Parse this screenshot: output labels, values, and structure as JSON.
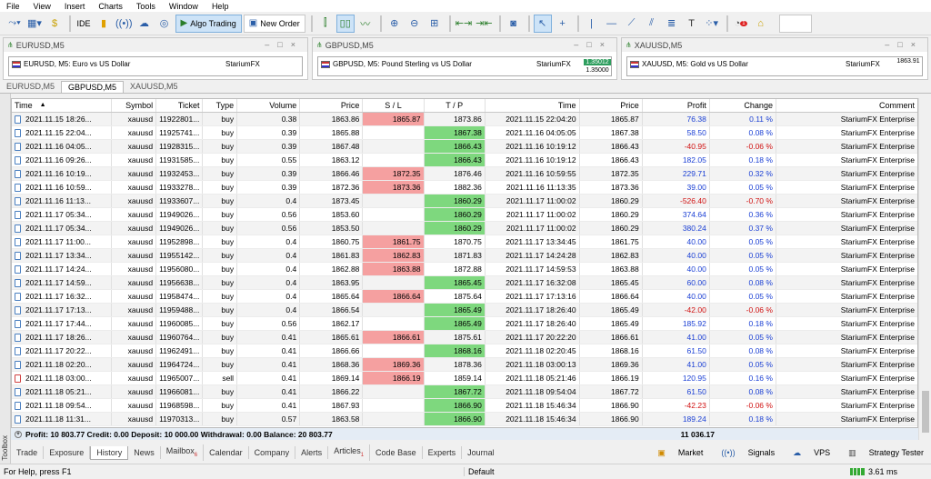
{
  "menu": [
    "File",
    "View",
    "Insert",
    "Charts",
    "Tools",
    "Window",
    "Help"
  ],
  "toolbar": {
    "ide_label": "IDE",
    "algo_label": "Algo Trading",
    "new_order_label": "New Order"
  },
  "chart_windows": [
    {
      "title": "EURUSD,M5",
      "label": "EURUSD, M5:  Euro vs US Dollar",
      "brand": "StariumFX"
    },
    {
      "title": "GBPUSD,M5",
      "label": "GBPUSD, M5:  Pound Sterling vs US Dollar",
      "brand": "StariumFX",
      "price_a": "1.35012",
      "price_b": "1.35000"
    },
    {
      "title": "XAUUSD,M5",
      "label": "XAUUSD, M5:  Gold vs US Dollar",
      "brand": "StariumFX",
      "price_a": "1863.91"
    }
  ],
  "chart_tabs": [
    "EURUSD,M5",
    "GBPUSD,M5",
    "XAUUSD,M5"
  ],
  "columns": [
    "Time",
    "Symbol",
    "Ticket",
    "Type",
    "Volume",
    "Price",
    "S / L",
    "T / P",
    "Time",
    "Price",
    "Profit",
    "Change",
    "Comment"
  ],
  "rows": [
    {
      "time": "2021.11.15 18:26...",
      "symbol": "xauusd",
      "ticket": "11922801...",
      "type": "buy",
      "volume": "0.38",
      "price": "1863.86",
      "sl": "1865.87",
      "tp": "1873.86",
      "ctime": "2021.11.15 22:04:20",
      "cprice": "1865.87",
      "profit": "76.38",
      "change": "0.11 %",
      "comment": "StariumFX Enterprise",
      "sl_hit": true,
      "tp_hit": false,
      "neg": false
    },
    {
      "time": "2021.11.15 22:04...",
      "symbol": "xauusd",
      "ticket": "11925741...",
      "type": "buy",
      "volume": "0.39",
      "price": "1865.88",
      "sl": "",
      "tp": "1867.38",
      "ctime": "2021.11.16 04:05:05",
      "cprice": "1867.38",
      "profit": "58.50",
      "change": "0.08 %",
      "comment": "StariumFX Enterprise",
      "sl_hit": false,
      "tp_hit": true,
      "neg": false
    },
    {
      "time": "2021.11.16 04:05...",
      "symbol": "xauusd",
      "ticket": "11928315...",
      "type": "buy",
      "volume": "0.39",
      "price": "1867.48",
      "sl": "",
      "tp": "1866.43",
      "ctime": "2021.11.16 10:19:12",
      "cprice": "1866.43",
      "profit": "-40.95",
      "change": "-0.06 %",
      "comment": "StariumFX Enterprise",
      "sl_hit": false,
      "tp_hit": true,
      "neg": true
    },
    {
      "time": "2021.11.16 09:26...",
      "symbol": "xauusd",
      "ticket": "11931585...",
      "type": "buy",
      "volume": "0.55",
      "price": "1863.12",
      "sl": "",
      "tp": "1866.43",
      "ctime": "2021.11.16 10:19:12",
      "cprice": "1866.43",
      "profit": "182.05",
      "change": "0.18 %",
      "comment": "StariumFX Enterprise",
      "sl_hit": false,
      "tp_hit": true,
      "neg": false
    },
    {
      "time": "2021.11.16 10:19...",
      "symbol": "xauusd",
      "ticket": "11932453...",
      "type": "buy",
      "volume": "0.39",
      "price": "1866.46",
      "sl": "1872.35",
      "tp": "1876.46",
      "ctime": "2021.11.16 10:59:55",
      "cprice": "1872.35",
      "profit": "229.71",
      "change": "0.32 %",
      "comment": "StariumFX Enterprise",
      "sl_hit": true,
      "tp_hit": false,
      "neg": false
    },
    {
      "time": "2021.11.16 10:59...",
      "symbol": "xauusd",
      "ticket": "11933278...",
      "type": "buy",
      "volume": "0.39",
      "price": "1872.36",
      "sl": "1873.36",
      "tp": "1882.36",
      "ctime": "2021.11.16 11:13:35",
      "cprice": "1873.36",
      "profit": "39.00",
      "change": "0.05 %",
      "comment": "StariumFX Enterprise",
      "sl_hit": true,
      "tp_hit": false,
      "neg": false
    },
    {
      "time": "2021.11.16 11:13...",
      "symbol": "xauusd",
      "ticket": "11933607...",
      "type": "buy",
      "volume": "0.4",
      "price": "1873.45",
      "sl": "",
      "tp": "1860.29",
      "ctime": "2021.11.17 11:00:02",
      "cprice": "1860.29",
      "profit": "-526.40",
      "change": "-0.70 %",
      "comment": "StariumFX Enterprise",
      "sl_hit": false,
      "tp_hit": true,
      "neg": true
    },
    {
      "time": "2021.11.17 05:34...",
      "symbol": "xauusd",
      "ticket": "11949026...",
      "type": "buy",
      "volume": "0.56",
      "price": "1853.60",
      "sl": "",
      "tp": "1860.29",
      "ctime": "2021.11.17 11:00:02",
      "cprice": "1860.29",
      "profit": "374.64",
      "change": "0.36 %",
      "comment": "StariumFX Enterprise",
      "sl_hit": false,
      "tp_hit": true,
      "neg": false
    },
    {
      "time": "2021.11.17 05:34...",
      "symbol": "xauusd",
      "ticket": "11949026...",
      "type": "buy",
      "volume": "0.56",
      "price": "1853.50",
      "sl": "",
      "tp": "1860.29",
      "ctime": "2021.11.17 11:00:02",
      "cprice": "1860.29",
      "profit": "380.24",
      "change": "0.37 %",
      "comment": "StariumFX Enterprise",
      "sl_hit": false,
      "tp_hit": true,
      "neg": false
    },
    {
      "time": "2021.11.17 11:00...",
      "symbol": "xauusd",
      "ticket": "11952898...",
      "type": "buy",
      "volume": "0.4",
      "price": "1860.75",
      "sl": "1861.75",
      "tp": "1870.75",
      "ctime": "2021.11.17 13:34:45",
      "cprice": "1861.75",
      "profit": "40.00",
      "change": "0.05 %",
      "comment": "StariumFX Enterprise",
      "sl_hit": true,
      "tp_hit": false,
      "neg": false
    },
    {
      "time": "2021.11.17 13:34...",
      "symbol": "xauusd",
      "ticket": "11955142...",
      "type": "buy",
      "volume": "0.4",
      "price": "1861.83",
      "sl": "1862.83",
      "tp": "1871.83",
      "ctime": "2021.11.17 14:24:28",
      "cprice": "1862.83",
      "profit": "40.00",
      "change": "0.05 %",
      "comment": "StariumFX Enterprise",
      "sl_hit": true,
      "tp_hit": false,
      "neg": false
    },
    {
      "time": "2021.11.17 14:24...",
      "symbol": "xauusd",
      "ticket": "11956080...",
      "type": "buy",
      "volume": "0.4",
      "price": "1862.88",
      "sl": "1863.88",
      "tp": "1872.88",
      "ctime": "2021.11.17 14:59:53",
      "cprice": "1863.88",
      "profit": "40.00",
      "change": "0.05 %",
      "comment": "StariumFX Enterprise",
      "sl_hit": true,
      "tp_hit": false,
      "neg": false
    },
    {
      "time": "2021.11.17 14:59...",
      "symbol": "xauusd",
      "ticket": "11956638...",
      "type": "buy",
      "volume": "0.4",
      "price": "1863.95",
      "sl": "",
      "tp": "1865.45",
      "ctime": "2021.11.17 16:32:08",
      "cprice": "1865.45",
      "profit": "60.00",
      "change": "0.08 %",
      "comment": "StariumFX Enterprise",
      "sl_hit": false,
      "tp_hit": true,
      "neg": false
    },
    {
      "time": "2021.11.17 16:32...",
      "symbol": "xauusd",
      "ticket": "11958474...",
      "type": "buy",
      "volume": "0.4",
      "price": "1865.64",
      "sl": "1866.64",
      "tp": "1875.64",
      "ctime": "2021.11.17 17:13:16",
      "cprice": "1866.64",
      "profit": "40.00",
      "change": "0.05 %",
      "comment": "StariumFX Enterprise",
      "sl_hit": true,
      "tp_hit": false,
      "neg": false
    },
    {
      "time": "2021.11.17 17:13...",
      "symbol": "xauusd",
      "ticket": "11959488...",
      "type": "buy",
      "volume": "0.4",
      "price": "1866.54",
      "sl": "",
      "tp": "1865.49",
      "ctime": "2021.11.17 18:26:40",
      "cprice": "1865.49",
      "profit": "-42.00",
      "change": "-0.06 %",
      "comment": "StariumFX Enterprise",
      "sl_hit": false,
      "tp_hit": true,
      "neg": true
    },
    {
      "time": "2021.11.17 17:44...",
      "symbol": "xauusd",
      "ticket": "11960085...",
      "type": "buy",
      "volume": "0.56",
      "price": "1862.17",
      "sl": "",
      "tp": "1865.49",
      "ctime": "2021.11.17 18:26:40",
      "cprice": "1865.49",
      "profit": "185.92",
      "change": "0.18 %",
      "comment": "StariumFX Enterprise",
      "sl_hit": false,
      "tp_hit": true,
      "neg": false
    },
    {
      "time": "2021.11.17 18:26...",
      "symbol": "xauusd",
      "ticket": "11960764...",
      "type": "buy",
      "volume": "0.41",
      "price": "1865.61",
      "sl": "1866.61",
      "tp": "1875.61",
      "ctime": "2021.11.17 20:22:20",
      "cprice": "1866.61",
      "profit": "41.00",
      "change": "0.05 %",
      "comment": "StariumFX Enterprise",
      "sl_hit": true,
      "tp_hit": false,
      "neg": false
    },
    {
      "time": "2021.11.17 20:22...",
      "symbol": "xauusd",
      "ticket": "11962491...",
      "type": "buy",
      "volume": "0.41",
      "price": "1866.66",
      "sl": "",
      "tp": "1868.16",
      "ctime": "2021.11.18 02:20:45",
      "cprice": "1868.16",
      "profit": "61.50",
      "change": "0.08 %",
      "comment": "StariumFX Enterprise",
      "sl_hit": false,
      "tp_hit": true,
      "neg": false
    },
    {
      "time": "2021.11.18 02:20...",
      "symbol": "xauusd",
      "ticket": "11964724...",
      "type": "buy",
      "volume": "0.41",
      "price": "1868.36",
      "sl": "1869.36",
      "tp": "1878.36",
      "ctime": "2021.11.18 03:00:13",
      "cprice": "1869.36",
      "profit": "41.00",
      "change": "0.05 %",
      "comment": "StariumFX Enterprise",
      "sl_hit": true,
      "tp_hit": false,
      "neg": false
    },
    {
      "time": "2021.11.18 03:00...",
      "symbol": "xauusd",
      "ticket": "11965007...",
      "type": "sell",
      "volume": "0.41",
      "price": "1869.14",
      "sl": "1866.19",
      "tp": "1859.14",
      "ctime": "2021.11.18 05:21:46",
      "cprice": "1866.19",
      "profit": "120.95",
      "change": "0.16 %",
      "comment": "StariumFX Enterprise",
      "sl_hit": true,
      "tp_hit": false,
      "neg": false
    },
    {
      "time": "2021.11.18 05:21...",
      "symbol": "xauusd",
      "ticket": "11966081...",
      "type": "buy",
      "volume": "0.41",
      "price": "1866.22",
      "sl": "",
      "tp": "1867.72",
      "ctime": "2021.11.18 09:54:04",
      "cprice": "1867.72",
      "profit": "61.50",
      "change": "0.08 %",
      "comment": "StariumFX Enterprise",
      "sl_hit": false,
      "tp_hit": true,
      "neg": false
    },
    {
      "time": "2021.11.18 09:54...",
      "symbol": "xauusd",
      "ticket": "11968598...",
      "type": "buy",
      "volume": "0.41",
      "price": "1867.93",
      "sl": "",
      "tp": "1866.90",
      "ctime": "2021.11.18 15:46:34",
      "cprice": "1866.90",
      "profit": "-42.23",
      "change": "-0.06 %",
      "comment": "StariumFX Enterprise",
      "sl_hit": false,
      "tp_hit": true,
      "neg": true
    },
    {
      "time": "2021.11.18 11:31...",
      "symbol": "xauusd",
      "ticket": "11970313...",
      "type": "buy",
      "volume": "0.57",
      "price": "1863.58",
      "sl": "",
      "tp": "1866.90",
      "ctime": "2021.11.18 15:46:34",
      "cprice": "1866.90",
      "profit": "189.24",
      "change": "0.18 %",
      "comment": "StariumFX Enterprise",
      "sl_hit": false,
      "tp_hit": true,
      "neg": false
    }
  ],
  "summary": {
    "text": "Profit: 10 803.77  Credit: 0.00  Deposit: 10 000.00  Withdrawal: 0.00  Balance: 20 803.77",
    "total": "11 036.17"
  },
  "toolbox_label": "Toolbox",
  "bottom_tabs": [
    {
      "label": "Trade",
      "badge": ""
    },
    {
      "label": "Exposure",
      "badge": ""
    },
    {
      "label": "History",
      "badge": ""
    },
    {
      "label": "News",
      "badge": ""
    },
    {
      "label": "Mailbox",
      "badge": "6"
    },
    {
      "label": "Calendar",
      "badge": ""
    },
    {
      "label": "Company",
      "badge": ""
    },
    {
      "label": "Alerts",
      "badge": ""
    },
    {
      "label": "Articles",
      "badge": "1"
    },
    {
      "label": "Code Base",
      "badge": ""
    },
    {
      "label": "Experts",
      "badge": ""
    },
    {
      "label": "Journal",
      "badge": ""
    }
  ],
  "right_buttons": {
    "market": "Market",
    "signals": "Signals",
    "vps": "VPS",
    "tester": "Strategy Tester"
  },
  "status": {
    "help": "For Help, press F1",
    "profile": "Default",
    "ping": "3.61 ms"
  },
  "colors": {
    "sl_bg": "#f5a0a0",
    "tp_bg": "#7ed87e",
    "positive": "#1a3fd4",
    "negative": "#d01010"
  }
}
